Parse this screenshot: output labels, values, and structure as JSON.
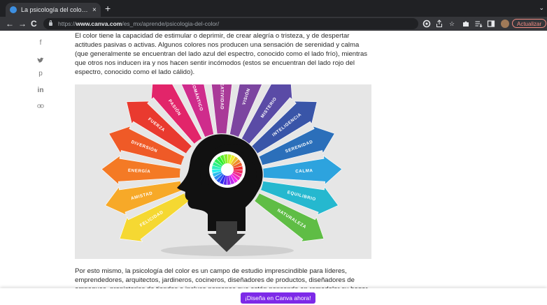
{
  "browser": {
    "tab": {
      "title": "La psicología del color: el sign",
      "close": "×"
    },
    "new_tab": "+",
    "tab_list": "⌄",
    "nav": {
      "back": "←",
      "forward": "→",
      "reload": "C"
    },
    "url": {
      "scheme": "https://",
      "host": "www.canva.com",
      "path": "/es_mx/aprende/psicologia-del-color/"
    },
    "update_button": "Actualizar",
    "colors": {
      "chrome_dark": "#202124",
      "toolbar": "#35363a",
      "update_accent": "#f28b82"
    }
  },
  "share": {
    "facebook": "f",
    "twitter": "twitter-bird-icon",
    "pinterest": "p",
    "linkedin": "in",
    "link": "link-icon"
  },
  "article": {
    "para1": "El color tiene la capacidad de estimular o deprimir, de crear alegría o tristeza, y de despertar actitudes pasivas o activas. Algunos colores nos producen una sensación de serenidad y calma (que generalmente se encuentran del lado azul del espectro, conocido como el lado frío), mientras que otros nos inducen ira y nos hacen sentir incómodos (estos se encuentran del lado rojo del espectro, conocido como el lado cálido).",
    "para2": "Por esto mismo, la psicología del color es un campo de estudio imprescindible para líderes, emprendedores, arquitectos, jardineros, cocineros, diseñadores de productos, diseñadores de empaques, propietarios de tiendas o incluso personas que estén pensando en remodelar su hogar. El"
  },
  "figure": {
    "labels": [
      "FELICIDAD",
      "AMISTAD",
      "ENERGÍA",
      "DIVERSIÓN",
      "FUERZA",
      "PASIÓN",
      "ROMÁNTICO",
      "CREATIVIDAD",
      "VISIÓN",
      "MISTERIO",
      "INTELIGENCIA",
      "SERENIDAD",
      "CALMA",
      "EQUILIBRIO",
      "NATURALEZA"
    ],
    "colors": [
      "#f5d832",
      "#f7a928",
      "#f47a25",
      "#ef5a27",
      "#e93a2f",
      "#e2256a",
      "#cf2c8c",
      "#a93a98",
      "#7c45a0",
      "#5a4ba6",
      "#3955a8",
      "#2b6fba",
      "#2da3de",
      "#25b8cf",
      "#5fbd45"
    ]
  },
  "cta": {
    "label": "¡Diseña en Canva ahora!",
    "color": "#7d2ae8"
  }
}
